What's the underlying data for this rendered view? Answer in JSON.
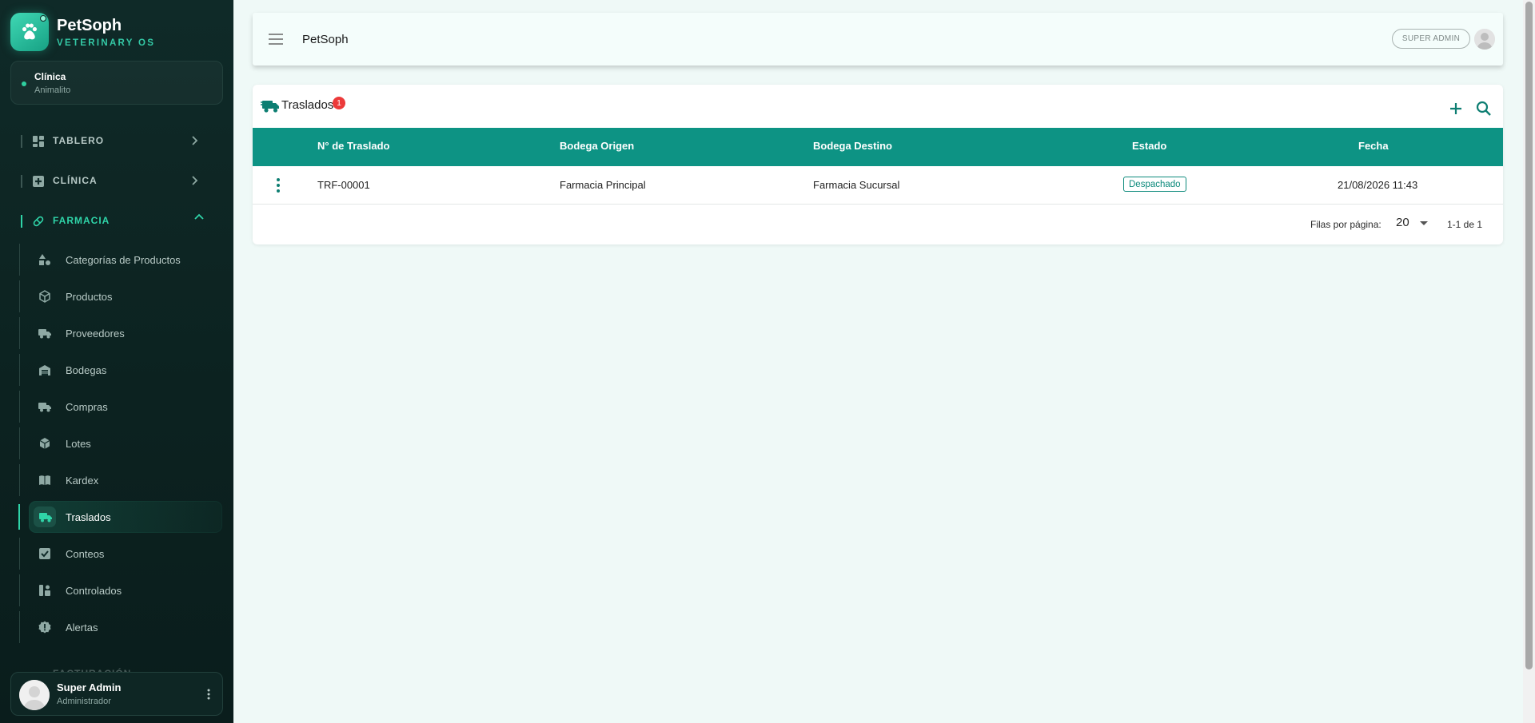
{
  "brand": {
    "name": "PetSoph",
    "subtitle": "VETERINARY OS"
  },
  "clinic": {
    "title": "Clínica",
    "name": "Animalito"
  },
  "sidebar": {
    "sections": [
      {
        "label": "TABLERO",
        "icon": "dashboard-icon",
        "expanded": false
      },
      {
        "label": "CLÍNICA",
        "icon": "medical-plus-icon",
        "expanded": false
      },
      {
        "label": "FARMACIA",
        "icon": "pill-icon",
        "expanded": true
      }
    ],
    "items": [
      {
        "label": "Categorías de Productos",
        "icon": "categories-icon"
      },
      {
        "label": "Productos",
        "icon": "box-icon"
      },
      {
        "label": "Proveedores",
        "icon": "truck-icon"
      },
      {
        "label": "Bodegas",
        "icon": "warehouse-icon"
      },
      {
        "label": "Compras",
        "icon": "truck-icon"
      },
      {
        "label": "Lotes",
        "icon": "box-icon"
      },
      {
        "label": "Kardex",
        "icon": "book-icon"
      },
      {
        "label": "Traslados",
        "icon": "truck-icon",
        "active": true
      },
      {
        "label": "Conteos",
        "icon": "checkbox-icon"
      },
      {
        "label": "Controlados",
        "icon": "controlled-icon"
      },
      {
        "label": "Alertas",
        "icon": "alert-icon"
      }
    ],
    "next_section": "FACTURACIÓN"
  },
  "user": {
    "name": "Super Admin",
    "role": "Administrador"
  },
  "topbar": {
    "title": "PetSoph",
    "role_chip": "SUPER ADMIN"
  },
  "page": {
    "title": "Traslados",
    "badge": "1",
    "columns": [
      "N° de Traslado",
      "Bodega Origen",
      "Bodega Destino",
      "Estado",
      "Fecha"
    ],
    "rows": [
      {
        "numero": "TRF-00001",
        "origen": "Farmacia Principal",
        "destino": "Farmacia Sucursal",
        "estado": "Despachado",
        "fecha": "21/08/2026 11:43"
      }
    ],
    "pagination": {
      "rows_per_page_label": "Filas por página:",
      "rows_per_page": "20",
      "range": "1-1 de 1"
    }
  },
  "colors": {
    "accent": "#0d9384",
    "sidebar_bg": "#0f2a28",
    "active_green": "#2fd4a8",
    "badge_red": "#ec3a3a"
  }
}
